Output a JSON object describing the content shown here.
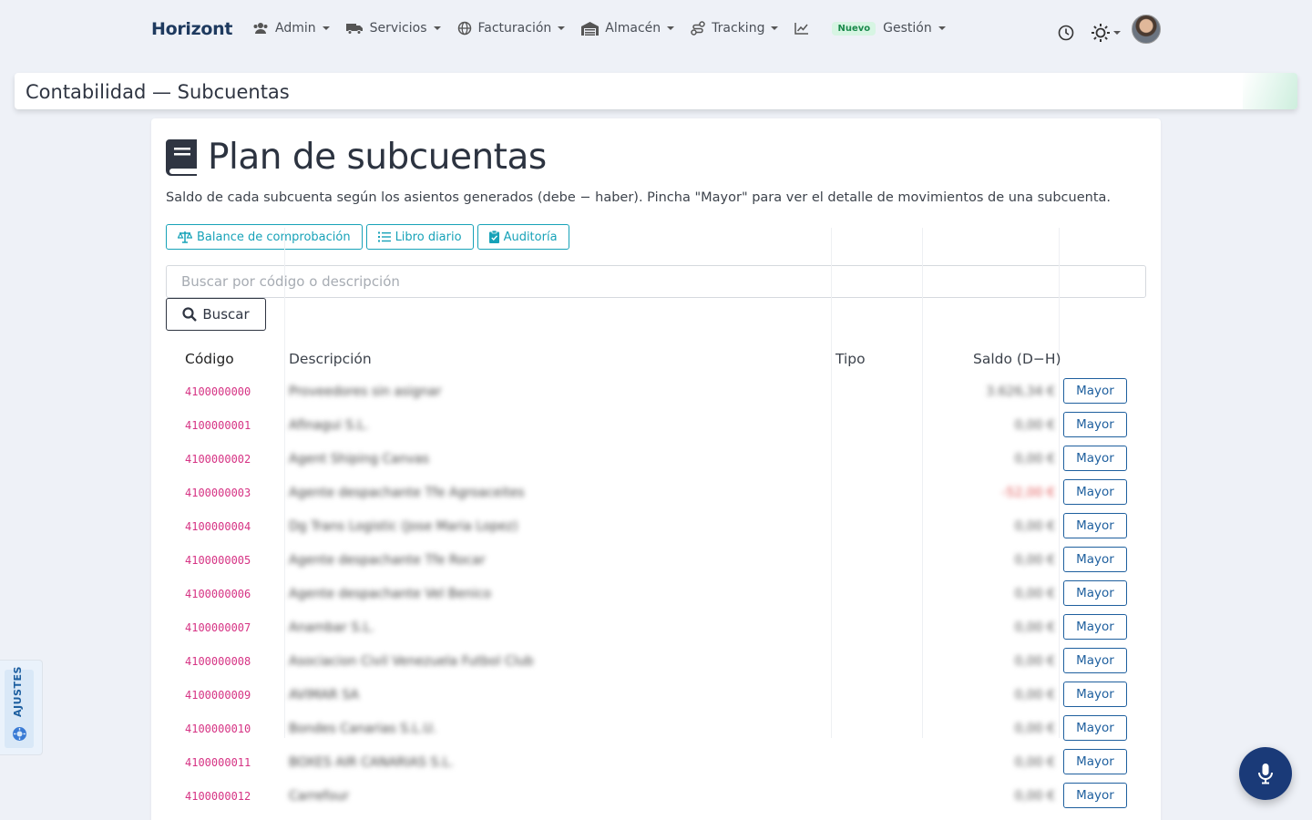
{
  "navbar": {
    "brand": "Horizont",
    "items": [
      {
        "label": "Admin",
        "icon": "users-icon"
      },
      {
        "label": "Servicios",
        "icon": "truck-icon"
      },
      {
        "label": "Facturación",
        "icon": "globe-icon"
      },
      {
        "label": "Almacén",
        "icon": "warehouse-icon"
      },
      {
        "label": "Tracking",
        "icon": "route-icon"
      }
    ],
    "chart_icon": "chart-line-icon",
    "new_badge": "Nuevo",
    "gestion_label": "Gestión",
    "right_icons": [
      "clock-icon",
      "sun-icon",
      "avatar"
    ]
  },
  "header": {
    "title": "Contabilidad — Subcuentas"
  },
  "page": {
    "title": "Plan de subcuentas",
    "title_icon": "book-icon",
    "subtitle": "Saldo de cada subcuenta según los asientos generados (debe − haber). Pincha \"Mayor\" para ver el detalle de movimientos de una subcuenta.",
    "buttons": {
      "balance": "Balance de comprobación",
      "libro": "Libro diario",
      "auditoria": "Auditoría"
    },
    "search": {
      "placeholder": "Buscar por código o descripción",
      "button": "Buscar"
    }
  },
  "table": {
    "columns": [
      "Código",
      "Descripción",
      "Tipo",
      "Saldo (D−H)"
    ],
    "action_label": "Mayor",
    "rows": [
      {
        "code": "4100000000",
        "desc": "Proveedores sin asignar",
        "saldo": "3.626,34 €",
        "negative": false
      },
      {
        "code": "4100000001",
        "desc": "Afinagui S.L.",
        "saldo": "0,00 €",
        "negative": false
      },
      {
        "code": "4100000002",
        "desc": "Agent Shiping Canvas",
        "saldo": "0,00 €",
        "negative": false
      },
      {
        "code": "4100000003",
        "desc": "Agente despachante Tfe Agroaceites",
        "saldo": "-52,00 €",
        "negative": true
      },
      {
        "code": "4100000004",
        "desc": "Dg Trans Logistic (Jose Maria Lopez)",
        "saldo": "0,00 €",
        "negative": false
      },
      {
        "code": "4100000005",
        "desc": "Agente despachante Tfe Rocar",
        "saldo": "0,00 €",
        "negative": false
      },
      {
        "code": "4100000006",
        "desc": "Agente despachante Vel Benico",
        "saldo": "0,00 €",
        "negative": false
      },
      {
        "code": "4100000007",
        "desc": "Anambar S.L.",
        "saldo": "0,00 €",
        "negative": false
      },
      {
        "code": "4100000008",
        "desc": "Asociacion Civil Venezuela Futbol Club",
        "saldo": "0,00 €",
        "negative": false
      },
      {
        "code": "4100000009",
        "desc": "AVIMAR SA",
        "saldo": "0,00 €",
        "negative": false
      },
      {
        "code": "4100000010",
        "desc": "Bondes Canarias S.L.U.",
        "saldo": "0,00 €",
        "negative": false
      },
      {
        "code": "4100000011",
        "desc": "BOXES AIR CANARIAS S.L.",
        "saldo": "0,00 €",
        "negative": false
      },
      {
        "code": "4100000012",
        "desc": "Carrefour",
        "saldo": "0,00 €",
        "negative": false
      }
    ]
  },
  "settings_tab": {
    "label": "AJUSTES"
  },
  "mic_button": {
    "icon": "microphone-icon"
  }
}
